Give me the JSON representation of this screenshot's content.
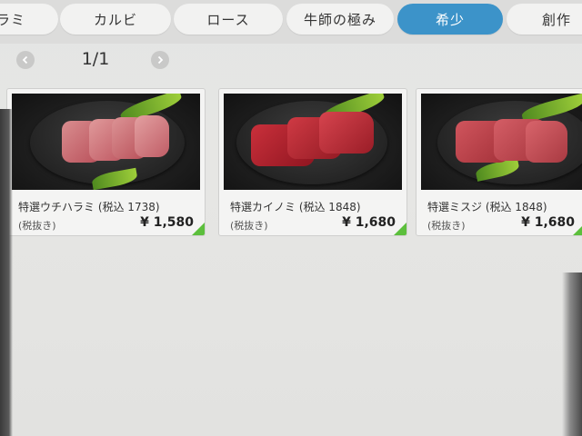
{
  "tabs": [
    {
      "label": "ラミ"
    },
    {
      "label": "カルビ"
    },
    {
      "label": "ロース"
    },
    {
      "label": "牛師の極み"
    },
    {
      "label": "希少"
    },
    {
      "label": "創作"
    }
  ],
  "active_tab": "希少",
  "pager": {
    "prev_icon": "chevron-left-icon",
    "next_icon": "chevron-right-icon",
    "indicator": "1/1"
  },
  "products": [
    {
      "name": "特選ウチハラミ (税込 1738)",
      "tax_note": "(税抜き)",
      "price": "¥ 1,580"
    },
    {
      "name": "特選カイノミ (税込 1848)",
      "tax_note": "(税抜き)",
      "price": "¥ 1,680"
    },
    {
      "name": "特選ミスジ (税込 1848)",
      "tax_note": "(税抜き)",
      "price": "¥ 1,680"
    }
  ],
  "colors": {
    "active_tab": "#3c93c9",
    "corner_mark": "#5cbf3c"
  }
}
